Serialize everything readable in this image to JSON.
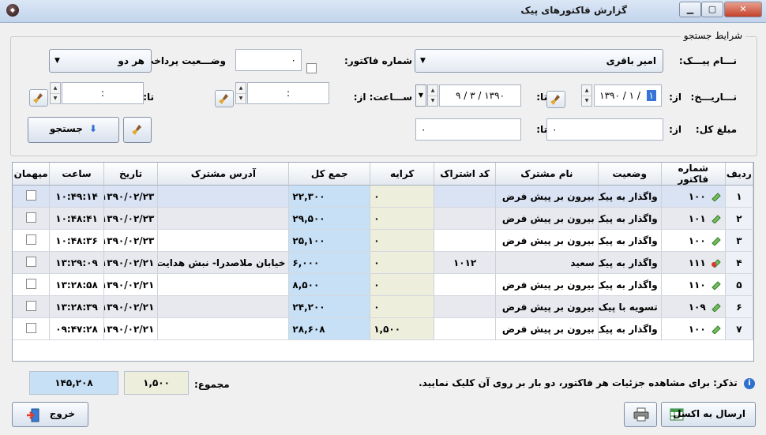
{
  "window": {
    "title": "گزارش فاکتورهای پیک"
  },
  "search": {
    "group_title": "شرایط جستجو",
    "courier_label": "نـــام پیـــک:",
    "courier_value": "امیر باقری",
    "invoice_no_label": "شماره فاکتور:",
    "invoice_no_value": "۰",
    "payment_status_label": "وضـــعیت پرداخت:",
    "payment_status_value": "هر دو",
    "date_label": "تـــاریـــخ:",
    "from_label": "از:",
    "to_label": "تا:",
    "date_from_value": "۱۳۹۰ / ۱ / ۱",
    "date_from_highlight": "۱",
    "date_to_value": "۱۳۹۰ / ۳ / ۹",
    "time_from_label": "ســـاعت: از:",
    "time_from_value": ":",
    "time_to_label": "تا:",
    "time_to_value": ":",
    "total_label": "مبلغ کل:",
    "total_from_label": "از:",
    "total_from_value": "۰",
    "total_to_label": "تا:",
    "total_to_value": "۰",
    "search_button": "جستجو"
  },
  "table": {
    "columns": [
      "ردیف",
      "شماره فاکتور",
      "وضعیت",
      "نام مشترک",
      "کد اشتراک",
      "کرایه",
      "جمع کل",
      "آدرس مشترک",
      "تاریخ",
      "ساعت",
      "میهمان"
    ],
    "rows": [
      {
        "radif": "۱",
        "invoice": "۱۰۰",
        "status": "واگذار به پیک",
        "customer": "بیرون بر پیش فرض",
        "code": "",
        "fare": "۰",
        "total": "۲۲,۳۰۰",
        "address": "",
        "date": "۱۳۹۰/۰۲/۲۳",
        "time": "۱۰:۴۹:۱۴",
        "guest": false
      },
      {
        "radif": "۲",
        "invoice": "۱۰۱",
        "status": "واگذار به پیک",
        "customer": "بیرون بر پیش فرض",
        "code": "",
        "fare": "۰",
        "total": "۲۹,۵۰۰",
        "address": "",
        "date": "۱۳۹۰/۰۲/۲۳",
        "time": "۱۰:۴۸:۴۱",
        "guest": false
      },
      {
        "radif": "۳",
        "invoice": "۱۰۰",
        "status": "واگذار به پیک",
        "customer": "بیرون بر پیش فرض",
        "code": "",
        "fare": "۰",
        "total": "۲۵,۱۰۰",
        "address": "",
        "date": "۱۳۹۰/۰۲/۲۳",
        "time": "۱۰:۴۸:۳۶",
        "guest": false
      },
      {
        "radif": "۴",
        "invoice": "۱۱۱",
        "status": "واگذار به پیک",
        "customer": "سعید",
        "code": "۱۰۱۲",
        "fare": "۰",
        "total": "۶,۰۰۰",
        "address": "خیابان ملاصدرا- نبش هدایت",
        "date": "۱۳۹۰/۰۲/۲۱",
        "time": "۱۳:۲۹:۰۹",
        "guest": false
      },
      {
        "radif": "۵",
        "invoice": "۱۱۰",
        "status": "واگذار به پیک",
        "customer": "بیرون بر پیش فرض",
        "code": "",
        "fare": "۰",
        "total": "۸,۵۰۰",
        "address": "",
        "date": "۱۳۹۰/۰۲/۲۱",
        "time": "۱۳:۲۸:۵۸",
        "guest": false
      },
      {
        "radif": "۶",
        "invoice": "۱۰۹",
        "status": "تسویه با پیک",
        "customer": "بیرون بر پیش فرض",
        "code": "",
        "fare": "۰",
        "total": "۲۴,۲۰۰",
        "address": "",
        "date": "۱۳۹۰/۰۲/۲۱",
        "time": "۱۳:۲۸:۳۹",
        "guest": false
      },
      {
        "radif": "۷",
        "invoice": "۱۰۰",
        "status": "واگذار به پیک",
        "customer": "بیرون بر پیش فرض",
        "code": "",
        "fare": "۱,۵۰۰",
        "total": "۲۸,۶۰۸",
        "address": "",
        "date": "۱۳۹۰/۰۲/۲۱",
        "time": "۰۹:۴۷:۲۸",
        "guest": false
      }
    ]
  },
  "footer": {
    "note": "تذکر: برای مشاهده جزئیات هر فاکتور، دو بار بر روی آن کلیک نمایید.",
    "sum_label": "مجموع:",
    "sum_fare": "۱,۵۰۰",
    "sum_total": "۱۴۵,۲۰۸",
    "export_button": "ارسال به اکسل",
    "exit_button": "خروج"
  },
  "colors": {
    "fare_column": "#eeeedd",
    "total_column": "#c8e0f6",
    "selected_row": "#d9e3f3",
    "accent": "#2f6fcf"
  }
}
